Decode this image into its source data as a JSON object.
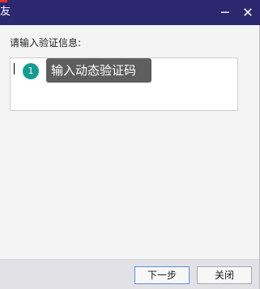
{
  "window": {
    "title": "友",
    "minimize_glyph": "minimize-icon",
    "close_glyph": "close-icon"
  },
  "form": {
    "prompt_label": "请输入验证信息:",
    "input_value": "",
    "tooltip_text": "输入动态验证码",
    "step_number": "1"
  },
  "footer": {
    "next_label": "下一步",
    "close_label": "关闭"
  },
  "colors": {
    "titlebar_bg": "#2b2870",
    "badge_bg": "#149c8f",
    "tooltip_bg": "#5e5e5e"
  }
}
